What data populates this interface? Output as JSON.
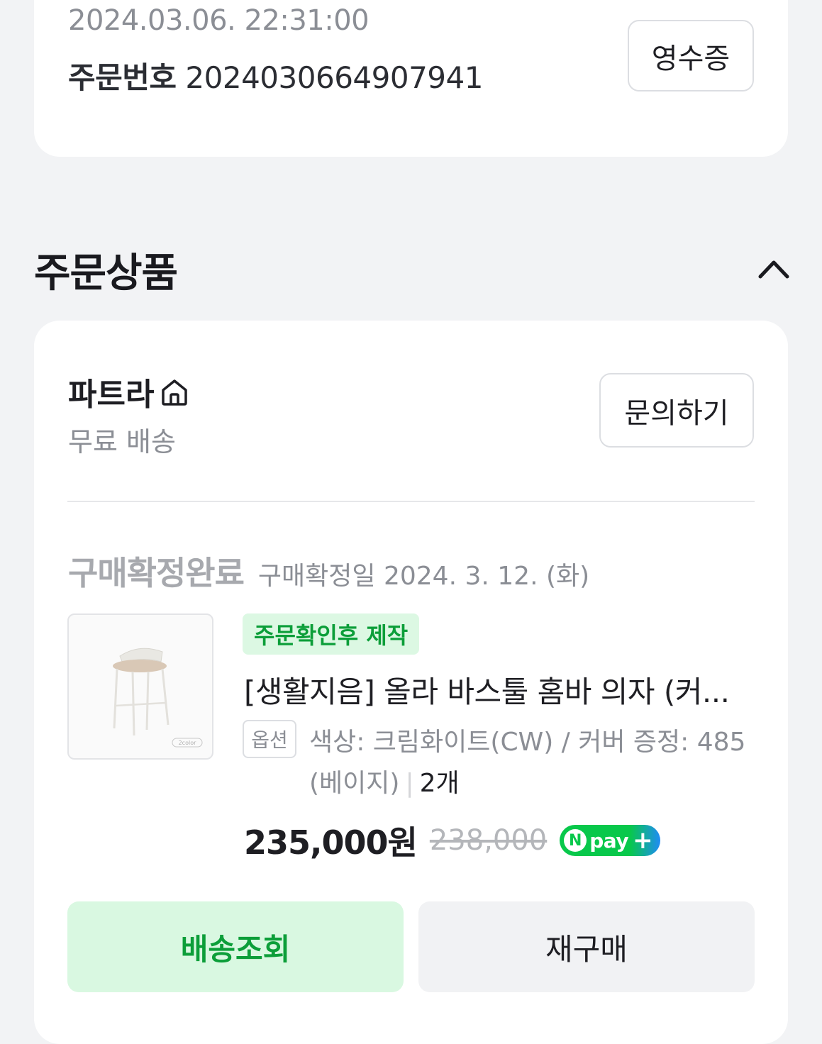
{
  "order": {
    "datetime": "2024.03.06. 22:31:00",
    "number_label": "주문번호",
    "number": "2024030664907941",
    "receipt_label": "영수증"
  },
  "section": {
    "title": "주문상품",
    "collapse_icon": "chevron-up-icon"
  },
  "seller": {
    "name": "파트라",
    "home_icon": "home-icon",
    "shipping": "무료 배송",
    "inquiry_label": "문의하기"
  },
  "status": {
    "main": "구매확정완료",
    "sub": "구매확정일 2024. 3. 12. (화)"
  },
  "product": {
    "badge": "주문확인후 제작",
    "title": "[생활지음] 올라 바스툴 홈바 의자 (커...",
    "option_tag": "옵션",
    "option_text": "색상: 크림화이트(CW) / 커버 증정: 485(베이지)",
    "quantity": "2개",
    "price": "235,000원",
    "original_price": "238,000",
    "pay_badge": "N pay +",
    "thumb_caption": "2color"
  },
  "actions": {
    "track_label": "배송조회",
    "rebuy_label": "재구매"
  },
  "colors": {
    "accent_green": "#0c9e39",
    "accent_green_bg": "#d9f8e1",
    "npay_green": "#08c84b",
    "npay_blue": "#1f8cf5"
  }
}
